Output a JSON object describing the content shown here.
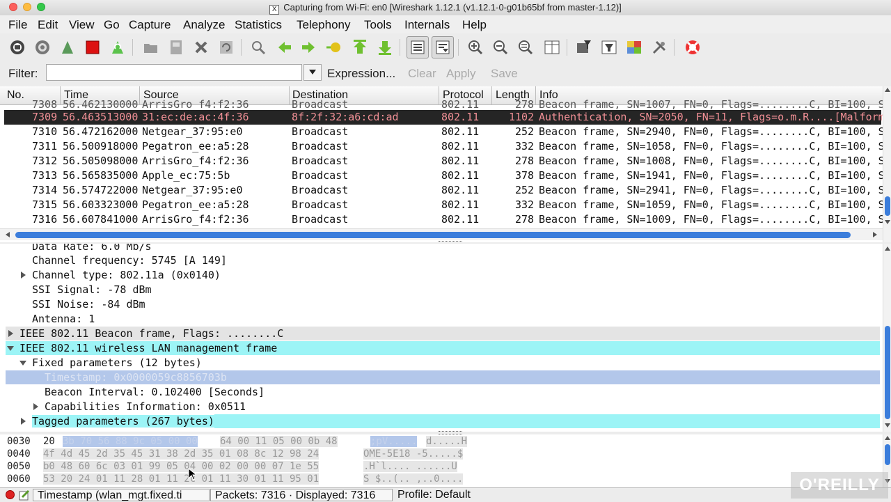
{
  "window": {
    "title": "Capturing from Wi-Fi: en0   [Wireshark 1.12.1  (v1.12.1-0-g01b65bf from master-1.12)]"
  },
  "menu": [
    "File",
    "Edit",
    "View",
    "Go",
    "Capture",
    "Analyze",
    "Statistics",
    "Telephony",
    "Tools",
    "Internals",
    "Help"
  ],
  "toolbar": {
    "icons": [
      "interfaces-icon",
      "options-icon",
      "start-capture-icon",
      "stop-capture-icon",
      "restart-capture-icon",
      "open-file-icon",
      "save-file-icon",
      "close-file-icon",
      "reload-icon",
      "find-packet-icon",
      "go-back-icon",
      "go-forward-icon",
      "go-to-packet-icon",
      "first-packet-icon",
      "last-packet-icon",
      "colorize-icon",
      "auto-scroll-icon",
      "zoom-in-icon",
      "zoom-out-icon",
      "normal-size-icon",
      "resize-columns-icon",
      "capture-filters-icon",
      "display-filters-icon",
      "coloring-rules-icon",
      "preferences-icon",
      "help-icon"
    ]
  },
  "filter": {
    "label": "Filter:",
    "value": "",
    "expression": "Expression...",
    "clear": "Clear",
    "apply": "Apply",
    "save": "Save"
  },
  "packet_list": {
    "columns": [
      "No.",
      "Time",
      "Source",
      "Destination",
      "Protocol",
      "Length",
      "Info"
    ],
    "partial_row": {
      "no": "7308",
      "time": "56.462130000",
      "source": "ArrisGro_f4:f2:36",
      "destination": "Broadcast",
      "protocol": "802.11",
      "length": "278",
      "info": "Beacon frame, SN=1007, FN=0, Flags=........C, BI=100, S"
    },
    "rows": [
      {
        "no": "7309",
        "time": "56.463513000",
        "source": "31:ec:de:ac:4f:36",
        "destination": "8f:2f:32:a6:cd:ad",
        "protocol": "802.11",
        "length": "1102",
        "info": "Authentication, SN=2050, FN=11, Flags=o.m.R....[Malform"
      },
      {
        "no": "7310",
        "time": "56.472162000",
        "source": "Netgear_37:95:e0",
        "destination": "Broadcast",
        "protocol": "802.11",
        "length": "252",
        "info": "Beacon frame, SN=2940, FN=0, Flags=........C, BI=100, S"
      },
      {
        "no": "7311",
        "time": "56.500918000",
        "source": "Pegatron_ee:a5:28",
        "destination": "Broadcast",
        "protocol": "802.11",
        "length": "332",
        "info": "Beacon frame, SN=1058, FN=0, Flags=........C, BI=100, S"
      },
      {
        "no": "7312",
        "time": "56.505098000",
        "source": "ArrisGro_f4:f2:36",
        "destination": "Broadcast",
        "protocol": "802.11",
        "length": "278",
        "info": "Beacon frame, SN=1008, FN=0, Flags=........C, BI=100, S"
      },
      {
        "no": "7313",
        "time": "56.565835000",
        "source": "Apple_ec:75:5b",
        "destination": "Broadcast",
        "protocol": "802.11",
        "length": "378",
        "info": "Beacon frame, SN=1941, FN=0, Flags=........C, BI=100, S"
      },
      {
        "no": "7314",
        "time": "56.574722000",
        "source": "Netgear_37:95:e0",
        "destination": "Broadcast",
        "protocol": "802.11",
        "length": "252",
        "info": "Beacon frame, SN=2941, FN=0, Flags=........C, BI=100, S"
      },
      {
        "no": "7315",
        "time": "56.603323000",
        "source": "Pegatron_ee:a5:28",
        "destination": "Broadcast",
        "protocol": "802.11",
        "length": "332",
        "info": "Beacon frame, SN=1059, FN=0, Flags=........C, BI=100, S"
      },
      {
        "no": "7316",
        "time": "56.607841000",
        "source": "ArrisGro_f4:f2:36",
        "destination": "Broadcast",
        "protocol": "802.11",
        "length": "278",
        "info": "Beacon frame, SN=1009, FN=0, Flags=........C, BI=100, S"
      }
    ]
  },
  "details": [
    {
      "text": "Data Rate: 6.0 Mb/s",
      "toggle": "none",
      "style": "plain"
    },
    {
      "text": "Channel frequency: 5745 [A 149]",
      "toggle": "none",
      "style": "plain"
    },
    {
      "text": "Channel type: 802.11a (0x0140)",
      "toggle": "right",
      "style": "plain"
    },
    {
      "text": "SSI Signal: -78 dBm",
      "toggle": "none",
      "style": "plain"
    },
    {
      "text": "SSI Noise: -84 dBm",
      "toggle": "none",
      "style": "plain"
    },
    {
      "text": "Antenna: 1",
      "toggle": "none",
      "style": "plain"
    },
    {
      "text": "IEEE 802.11 Beacon frame, Flags: ........C",
      "toggle": "right",
      "style": "gray"
    },
    {
      "text": "IEEE 802.11 wireless LAN management frame",
      "toggle": "down",
      "style": "cyan"
    },
    {
      "text": "Fixed parameters (12 bytes)",
      "toggle": "down",
      "style": "plain"
    },
    {
      "text": "Timestamp: 0x0000059c8856703b",
      "toggle": "none",
      "style": "selected"
    },
    {
      "text": "Beacon Interval: 0.102400 [Seconds]",
      "toggle": "none",
      "style": "plain"
    },
    {
      "text": "Capabilities Information: 0x0511",
      "toggle": "right",
      "style": "plain"
    },
    {
      "text": "Tagged parameters (267 bytes)",
      "toggle": "right",
      "style": "cyan"
    }
  ],
  "bytes": [
    {
      "offset": "0030",
      "plain_hex": "20",
      "sel_hex": "3b 70 56 88 9c 05 00  00",
      "rest_hex": "64 00 11 05 00 0b 48",
      "sel_ascii": ";pV.....",
      "rest_ascii": "d.....H"
    },
    {
      "offset": "0040",
      "plain_hex": "",
      "sel_hex": "",
      "rest_hex": "4f 4d 45 2d 35 45 31 38  2d 35 01 08 8c 12 98 24",
      "sel_ascii": "",
      "rest_ascii": "OME-5E18 -5.....$"
    },
    {
      "offset": "0050",
      "plain_hex": "",
      "sel_hex": "",
      "rest_hex": "b0 48 60 6c 03 01 99 05  04 00 02 00 00 07 1e 55",
      "sel_ascii": "",
      "rest_ascii": ".H`l.... ......U"
    },
    {
      "offset": "0060",
      "plain_hex": "",
      "sel_hex": "",
      "rest_hex": "53 20 24 01 11 28 01 11  2c 01 11 30 01 11 95 01",
      "sel_ascii": "",
      "rest_ascii": "S $..(.. ,..0...."
    }
  ],
  "status": {
    "field": "Timestamp (wlan_mgt.fixed.ti",
    "packets": "Packets: 7316 · Displayed: 7316",
    "profile": "Profile: Default"
  },
  "watermark": "O'REILLY"
}
